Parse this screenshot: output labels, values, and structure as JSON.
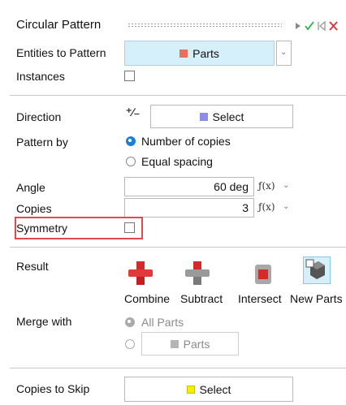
{
  "title": "Circular Pattern",
  "header_icons": [
    "play-icon",
    "check-icon",
    "reset-icon",
    "close-icon"
  ],
  "entities": {
    "label": "Entities to Pattern",
    "button": "Parts",
    "swatch": "#e8705a"
  },
  "instances": {
    "label": "Instances",
    "checked": false
  },
  "direction": {
    "label": "Direction",
    "button": "Select",
    "swatch": "#8c8ce6"
  },
  "pattern_by": {
    "label": "Pattern by",
    "options": [
      "Number of copies",
      "Equal spacing"
    ],
    "selected": "Number of copies"
  },
  "angle": {
    "label": "Angle",
    "value": "60 deg"
  },
  "copies": {
    "label": "Copies",
    "value": "3"
  },
  "symmetry": {
    "label": "Symmetry",
    "checked": false
  },
  "result": {
    "label": "Result",
    "options": [
      "Combine",
      "Subtract",
      "Intersect",
      "New Parts"
    ],
    "selected": "New Parts"
  },
  "merge_with": {
    "label": "Merge with",
    "options": [
      "All Parts",
      "Parts"
    ],
    "selected": "All Parts",
    "disabled": true
  },
  "copies_to_skip": {
    "label": "Copies to Skip",
    "button": "Select",
    "swatch": "#f5f000"
  },
  "colors": {
    "accent": "#1d7fd1",
    "highlight": "#e04a4a",
    "selected_button_bg": "#d6f0fb"
  }
}
